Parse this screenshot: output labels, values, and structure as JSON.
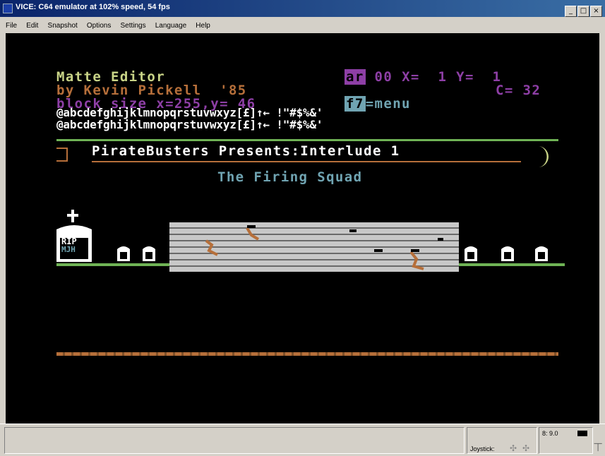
{
  "window": {
    "title": "VICE: C64 emulator at 102% speed, 54 fps",
    "buttons": [
      "_",
      "□",
      "×"
    ]
  },
  "menubar": {
    "items": [
      "File",
      "Edit",
      "Snapshot",
      "Options",
      "Settings",
      "Language",
      "Help"
    ]
  },
  "c64": {
    "title": "Matte Editor",
    "byline": "by Kevin Pickell  '85",
    "blocksize": "block size x=255,y= 46",
    "ar_label": "ar",
    "ar_value": "00",
    "x_label": "X=",
    "x_value": "1",
    "y_label": "Y=",
    "y_value": "1",
    "c_label": "C=",
    "c_value": "32",
    "f7_label": "f7",
    "menu_label": "=menu",
    "charset1": "@abcdefghijklmnopqrstuvwxyz[£]↑← !\"#$%&'",
    "charset2": "@abcdefghijklmnopqrstuvwxyz[£]↑← !\"#$%&'",
    "banner": "PirateBusters Presents:Interlude 1",
    "subtitle": "The Firing Squad",
    "tomb_rip": "RIP",
    "tomb_initials": "MJH"
  },
  "statusbar": {
    "joystick_label": "Joystick:",
    "drive_label": "8: 9.0"
  },
  "colors": {
    "c64_yellow": "#c9d487",
    "c64_orange": "#b66f3a",
    "c64_purple": "#8e3fa6",
    "c64_white": "#ffffff",
    "c64_green": "#6fb355",
    "c64_cyan": "#70a4b2",
    "c64_brown": "#7f5028",
    "c64_grey": "#adadad"
  }
}
